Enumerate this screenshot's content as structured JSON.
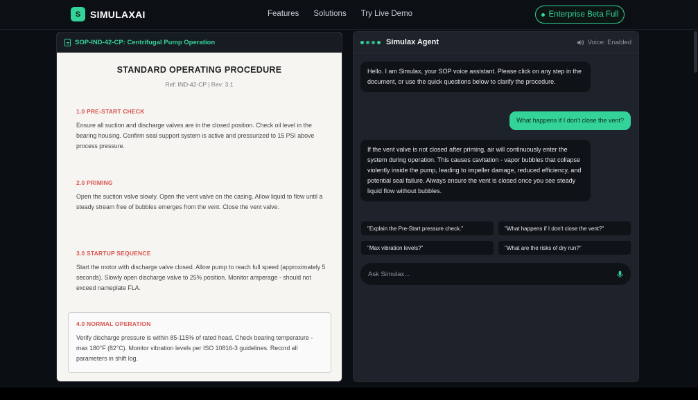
{
  "header": {
    "brand_mark": "S",
    "brand_name": "SIMULAXAI",
    "nav": [
      "Features",
      "Solutions",
      "Try Live Demo"
    ],
    "enterprise_label": "Enterprise Beta Full"
  },
  "document": {
    "tab_title": "SOP-IND-42-CP: Centrifugal Pump Operation",
    "title": "STANDARD OPERATING PROCEDURE",
    "ref": "Ref: IND-42-CP | Rev: 3.1",
    "sections": [
      {
        "heading": "1.0 PRE-START CHECK",
        "body": "Ensure all suction and discharge valves are in the closed position. Check oil level in the bearing housing. Confirm seal support system is active and pressurized to 15 PSI above process pressure."
      },
      {
        "heading": "2.0 PRIMING",
        "body": "Open the suction valve slowly. Open the vent valve on the casing. Allow liquid to flow until a steady stream free of bubbles emerges from the vent. Close the vent valve."
      },
      {
        "heading": "3.0 STARTUP SEQUENCE",
        "body": "Start the motor with discharge valve closed. Allow pump to reach full speed (approximately 5 seconds). Slowly open discharge valve to 25% position. Monitor amperage - should not exceed nameplate FLA."
      },
      {
        "heading": "4.0 NORMAL OPERATION",
        "body": "Verify discharge pressure is within 85-115% of rated head. Check bearing temperature - max 180°F (82°C). Monitor vibration levels per ISO 10816-3 guidelines. Record all parameters in shift log."
      }
    ]
  },
  "agent": {
    "title": "Simulax Agent",
    "voice_status": "Voice: Enabled",
    "messages": [
      {
        "role": "bot",
        "text": "Hello. I am Simulax, your SOP voice assistant. Please click on any step in the document, or use the quick questions below to clarify the procedure."
      },
      {
        "role": "user",
        "text": "What happens if I don't close the vent?"
      },
      {
        "role": "bot",
        "text": "If the vent valve is not closed after priming, air will continuously enter the system during operation. This causes cavitation - vapor bubbles that collapse violently inside the pump, leading to impeller damage, reduced efficiency, and potential seal failure. Always ensure the vent is closed once you see steady liquid flow without bubbles."
      }
    ],
    "quick_questions": [
      "\"Explain the Pre-Start pressure check.\"",
      "\"What happens if I don't close the vent?\"",
      "\"Max vibration levels?\"",
      "\"What are the risks of dry run?\""
    ],
    "input_placeholder": "Ask Simulax..."
  },
  "colors": {
    "accent": "#34d399",
    "section_heading": "#d9534f",
    "page_bg": "#0b0e13"
  },
  "icons": [
    "document-icon",
    "speaker-icon",
    "microphone-icon"
  ]
}
